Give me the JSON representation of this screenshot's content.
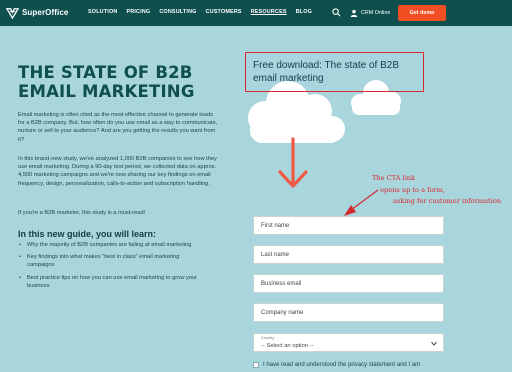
{
  "header": {
    "logo": "SuperOffice",
    "nav": [
      "SOLUTION",
      "PRICING",
      "CONSULTING",
      "CUSTOMERS",
      "RESOURCES",
      "BLOG"
    ],
    "active_nav": "RESOURCES",
    "crm_label": "CRM Online",
    "cta_label": "Get demo"
  },
  "hero": {
    "headline_line1": "THE STATE OF B2B",
    "headline_line2": "EMAIL MARKETING",
    "paragraph1": "Email marketing is often cited as the most effective channel to generate leads for a B2B company. But, how often do you use email as a way to communicate, nurture or sell to your audience? And are you getting the results you want from it?",
    "paragraph2": "In this brand-new study, we've analyzed 1,000 B2B companies to see how they use email marketing. During a 90-day test period, we collected data on approx. 4,500 marketing campaigns and we're now sharing our key findings on email frequency, design, personalization, calls-to-action and subscription handling.",
    "paragraph3": "If you're a B2B marketer, this study is a must-read!",
    "guide_title": "In this new guide, you will learn:",
    "bullets": [
      "Why the majority of B2B companies are failing at email marketing",
      "Key findings into what makes \"best in class\" email marketing campaigns",
      "Best practice tips on how you can use email marketing to grow your business"
    ]
  },
  "download": {
    "title": "Free download: The state of B2B email marketing"
  },
  "annotation": {
    "line1": "The CTA link",
    "line2": "opens up to a form,",
    "line3": "asking for customer information"
  },
  "form": {
    "first_name": "First name",
    "last_name": "Last name",
    "email": "Business email",
    "company": "Company name",
    "country_label": "Country",
    "country_value": "-- Select an option --",
    "consent": "I have read and understood the privacy statement and I am"
  },
  "colors": {
    "background": "#a9d6dc",
    "header": "#0f4f4e",
    "accent": "#f04e23",
    "annotation": "#d7282f"
  },
  "icons": {
    "logo": "superoffice-logo-icon",
    "search": "search-icon",
    "user": "user-icon",
    "chevron": "chevron-down-icon"
  }
}
